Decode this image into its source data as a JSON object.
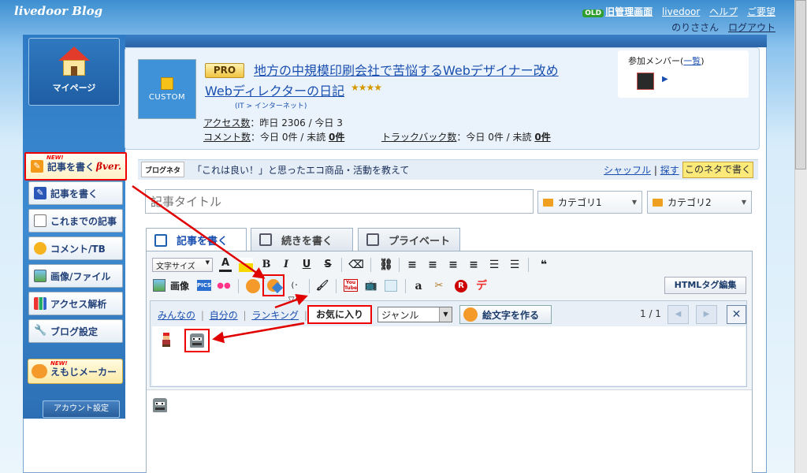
{
  "header": {
    "logo_text": "livedoor Blog",
    "old_badge": "OLD",
    "links": [
      "旧管理画面",
      "livedoor",
      "ヘルプ",
      "ご要望"
    ],
    "user_name": "のりささん",
    "logout": "ログアウト"
  },
  "sidebar": {
    "mypage_label": "マイページ",
    "new_badge": "NEW!",
    "items": [
      {
        "label": "記事を書く",
        "suffix": "βver."
      },
      {
        "label": "記事を書く"
      },
      {
        "label": "これまでの記事"
      },
      {
        "label": "コメント/TB"
      },
      {
        "label": "画像/ファイル"
      },
      {
        "label": "アクセス解析"
      },
      {
        "label": "ブログ設定"
      }
    ],
    "emoji_maker": "えもじメーカー",
    "account_settings": "アカウント設定"
  },
  "blog": {
    "design_label": "CUSTOM",
    "pro_badge": "PRO",
    "title_line1": "地方の中規模印刷会社で苦悩するWebデザイナー改め",
    "title_line2": "Webディレクターの日記",
    "stars": "★★★★",
    "category": "(IT > インターネット)",
    "access_label": "アクセス数",
    "access_text": "：昨日 2306 / 今日 3",
    "comment_label": "コメント数",
    "comment_text": "：今日 0件 / 未読",
    "comment_unread": "0件",
    "trackback_label": "トラックバック数",
    "trackback_text": "：今日 0件 / 未読",
    "trackback_unread": "0件",
    "members_label": "参加メンバー",
    "members_link": "一覧"
  },
  "topic": {
    "tag": "ブログネタ",
    "text": "「これは良い！」と思ったエコ商品・活動を教えて",
    "shuffle": "シャッフル",
    "search": "探す",
    "write_with": "このネタで書く"
  },
  "editor": {
    "title_placeholder": "記事タイトル",
    "category1": "カテゴリ1",
    "category2": "カテゴリ2",
    "tabs": [
      "記事を書く",
      "続きを書く",
      "プライベート"
    ],
    "font_size": "文字サイズ",
    "image_label": "画像",
    "html_tag_edit": "HTMLタグ編集"
  },
  "emoji_picker": {
    "tabs": [
      "みんなの",
      "自分の",
      "ランキング"
    ],
    "favorites": "お気に入り",
    "genre": "ジャンル",
    "make_emoji": "絵文字を作る",
    "page": "1 / 1"
  },
  "colors": {
    "accent": "#1a4fb0",
    "highlight": "#e00000",
    "nav_blue": "#2e7ac4"
  }
}
